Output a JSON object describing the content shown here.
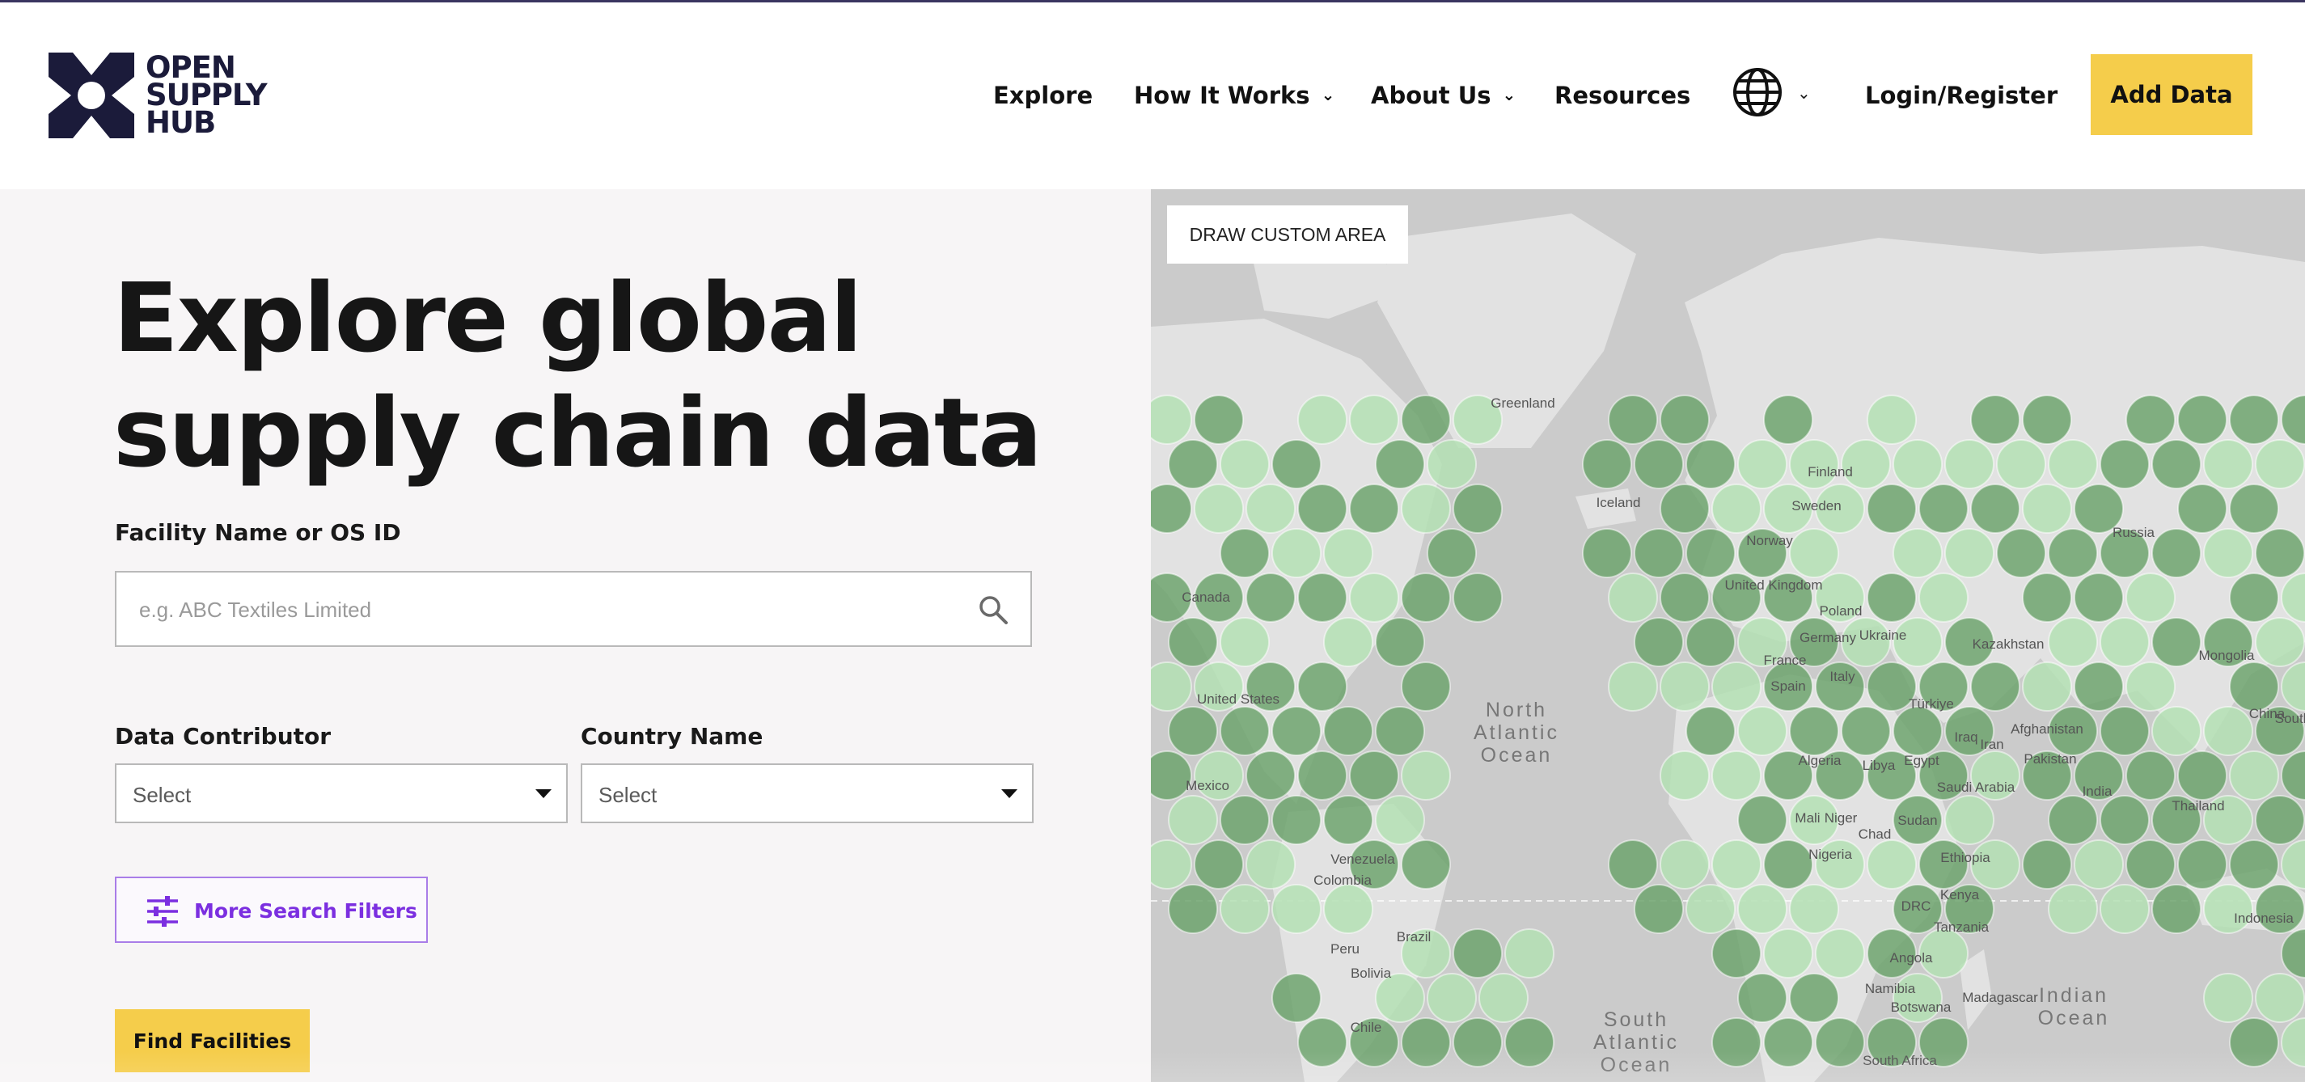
{
  "brand": {
    "name_lines": [
      "OPEN",
      "SUPPLY",
      "HUB"
    ],
    "colors": {
      "navy": "#1b1b3a",
      "accent_yellow": "#f5cd4b",
      "accent_purple": "#7b2fe0",
      "cluster_dark": "#6ea56e",
      "cluster_light": "#b4e0b4"
    }
  },
  "nav": {
    "explore": "Explore",
    "how_it_works": "How It Works",
    "about_us": "About Us",
    "resources": "Resources",
    "language_icon": "globe-icon",
    "login": "Login/Register",
    "add_data": "Add Data"
  },
  "hero": {
    "line1": "Explore global",
    "line2": "supply chain data"
  },
  "search": {
    "label": "Facility Name or OS ID",
    "placeholder": "e.g. ABC Textiles Limited",
    "value": "",
    "icon": "search-icon"
  },
  "filters": {
    "contributor": {
      "label": "Data Contributor",
      "value": "Select"
    },
    "country": {
      "label": "Country Name",
      "value": "Select"
    },
    "more_label": "More Search Filters",
    "more_icon": "sliders-icon"
  },
  "find_button": "Find Facilities",
  "map": {
    "draw_button": "DRAW CUSTOM AREA",
    "labels": {
      "greenland": "Greenland",
      "iceland": "Iceland",
      "finland": "Finland",
      "sweden": "Sweden",
      "norway": "Norway",
      "russia": "Russia",
      "canada": "Canada",
      "united_kingdom": "United Kingdom",
      "poland": "Poland",
      "germany": "Germany",
      "ukraine": "Ukraine",
      "kazakhstan": "Kazakhstan",
      "france": "France",
      "italy": "Italy",
      "mongolia": "Mongolia",
      "united_states": "United States",
      "spain": "Spain",
      "turkiye": "Türkiye",
      "north_atlantic": "North Atlantic Ocean",
      "china": "China",
      "south_korea": "South K",
      "afghanistan": "Afghanistan",
      "iraq": "Iraq",
      "iran": "Iran",
      "pakistan": "Pakistan",
      "algeria": "Algeria",
      "libya": "Libya",
      "egypt": "Egypt",
      "saudi_arabia": "Saudi Arabia",
      "mexico": "Mexico",
      "india": "India",
      "thailand": "Thailand",
      "mali": "Mali",
      "niger": "Niger",
      "chad": "Chad",
      "sudan": "Sudan",
      "nigeria": "Nigeria",
      "ethiopia": "Ethiopia",
      "venezuela": "Venezuela",
      "colombia": "Colombia",
      "kenya": "Kenya",
      "drc": "DRC",
      "tanzania": "Tanzania",
      "indonesia": "Indonesia",
      "brazil": "Brazil",
      "peru": "Peru",
      "bolivia": "Bolivia",
      "angola": "Angola",
      "namibia": "Namibia",
      "botswana": "Botswana",
      "madagascar": "Madagascar",
      "indian_ocean": "Indian Ocean",
      "south_atlantic": "South Atlantic Ocean",
      "chile": "Chile",
      "south_africa": "South Africa"
    }
  }
}
